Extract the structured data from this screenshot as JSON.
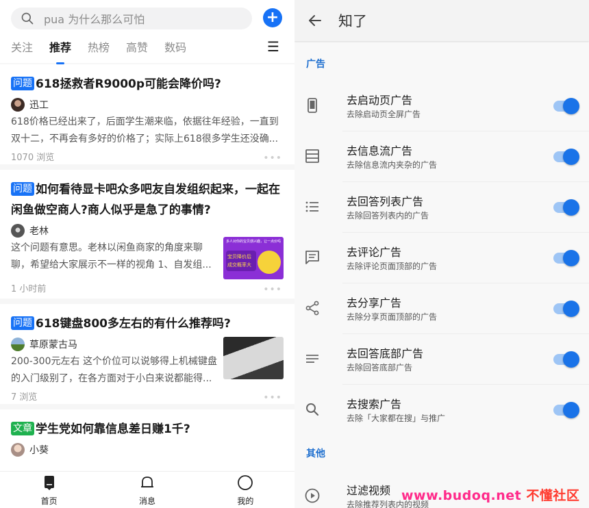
{
  "left": {
    "search": {
      "placeholder": "pua 为什么那么可怕"
    },
    "tabs": [
      "关注",
      "推荐",
      "热榜",
      "高赞",
      "数码"
    ],
    "active_tab": "推荐",
    "cards": [
      {
        "badge": "问题",
        "title": "618拯救者R9000p可能会降价吗?",
        "author": "迅工",
        "excerpt": "618价格已经出来了，后面学生潮来临，依据往年经验，一直到双十二，不再会有多好的价格了；实际上618很多学生还没确...",
        "meta": "1070 浏览"
      },
      {
        "badge": "问题",
        "title": "如何看待显卡吧众多吧友自发组织起来，一起在闲鱼做空商人?商人似乎是急了的事情?",
        "author": "老林",
        "excerpt": "这个问题有意思。老林以闲鱼商家的角度来聊聊，希望给大家展示不一样的视角 1、自发组...",
        "meta": "1 小时前",
        "thumb_text": [
          "多人对你的宝贝感兴趣，让一点价吗",
          "宝贝降价后",
          "成交概率大"
        ]
      },
      {
        "badge": "问题",
        "title": "618键盘800多左右的有什么推荐吗?",
        "author": "草原蒙古马",
        "excerpt": "200-300元左右 这个价位可以说够得上机械键盘的入门级别了，在各方面对于小白来说都能得...",
        "meta": "7 浏览"
      },
      {
        "badge": "文章",
        "title": "学生党如何靠信息差日赚1千?",
        "author": "小葵"
      }
    ],
    "nav": [
      "首页",
      "消息",
      "我的"
    ]
  },
  "right": {
    "app_title": "知了",
    "section_ads": "广告",
    "section_other": "其他",
    "settings": [
      {
        "title": "去启动页广告",
        "subtitle": "去除启动页全屏广告",
        "icon": "phone-icon",
        "enabled": true
      },
      {
        "title": "去信息流广告",
        "subtitle": "去除信息流内夹杂的广告",
        "icon": "feed-icon",
        "enabled": true
      },
      {
        "title": "去回答列表广告",
        "subtitle": "去除回答列表内的广告",
        "icon": "list-icon",
        "enabled": true
      },
      {
        "title": "去评论广告",
        "subtitle": "去除评论页面顶部的广告",
        "icon": "comment-icon",
        "enabled": true
      },
      {
        "title": "去分享广告",
        "subtitle": "去除分享页面顶部的广告",
        "icon": "share-icon",
        "enabled": true
      },
      {
        "title": "去回答底部广告",
        "subtitle": "去除回答底部广告",
        "icon": "lines-icon",
        "enabled": true
      },
      {
        "title": "去搜索广告",
        "subtitle": "去除「大家都在搜」与推广",
        "icon": "search-icon",
        "enabled": true
      }
    ],
    "other": {
      "title": "过滤视频",
      "subtitle": "去除推荐列表内的视频",
      "icon": "play-icon"
    },
    "watermark": {
      "site": "www.budoq.net",
      "name": "不懂社区"
    }
  },
  "colors": {
    "accent": "#1772f6",
    "switch_on": "#1a73e8",
    "section": "#1e6fcf",
    "article_badge": "#1fb14f"
  }
}
